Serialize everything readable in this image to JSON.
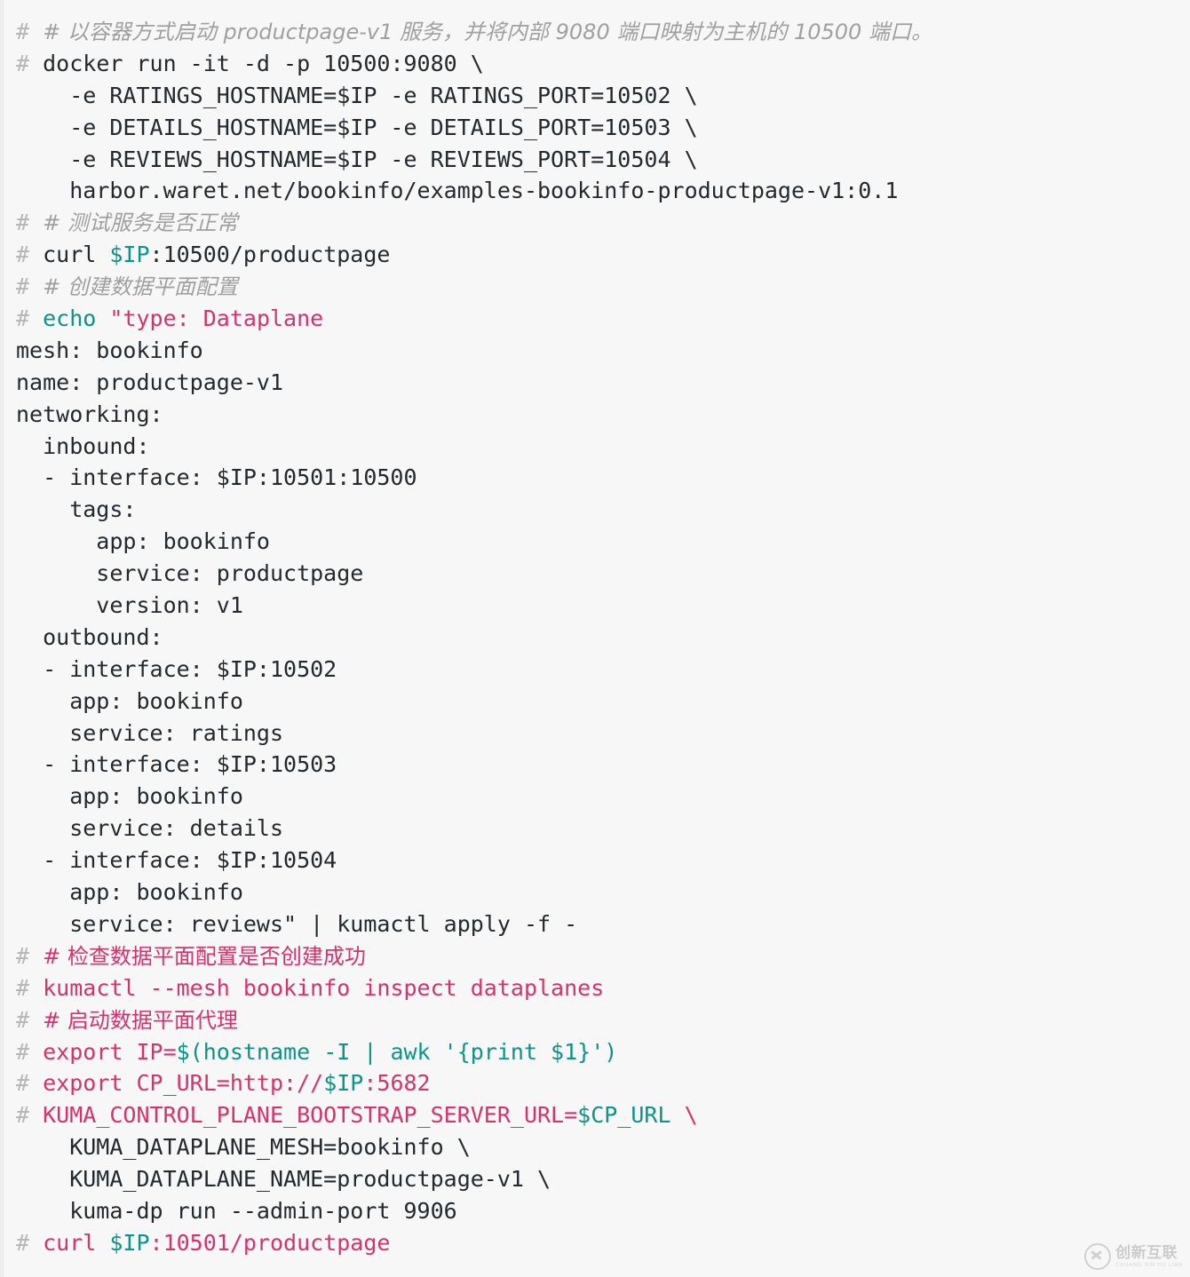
{
  "document": {
    "kind": "terminal-code-block",
    "background_color": "#f7f7f7",
    "colors": {
      "plain": "#24292e",
      "comment_gray": "#a0a0a0",
      "prefix_gray": "#b6b6b6",
      "variable_teal": "#0d9488",
      "string_crimson": "#d6336c"
    }
  },
  "lines": [
    {
      "id": "line-1",
      "tokens": [
        {
          "t": "# ",
          "c": "prefix"
        },
        {
          "t": "# 以容器方式启动 productpage-v1 服务，并将内部 9080 端口映射为主机的 10500 端口。",
          "c": "comment",
          "cjk": true
        }
      ]
    },
    {
      "id": "line-2",
      "tokens": [
        {
          "t": "# ",
          "c": "prefix"
        },
        {
          "t": "docker run -it -d -p 10500:9080 \\",
          "c": "plain"
        }
      ]
    },
    {
      "id": "line-3",
      "tokens": [
        {
          "t": "    -e RATINGS_HOSTNAME=$IP -e RATINGS_PORT=10502 \\",
          "c": "plain"
        }
      ]
    },
    {
      "id": "line-4",
      "tokens": [
        {
          "t": "    -e DETAILS_HOSTNAME=$IP -e DETAILS_PORT=10503 \\",
          "c": "plain"
        }
      ]
    },
    {
      "id": "line-5",
      "tokens": [
        {
          "t": "    -e REVIEWS_HOSTNAME=$IP -e REVIEWS_PORT=10504 \\",
          "c": "plain"
        }
      ]
    },
    {
      "id": "line-6",
      "tokens": [
        {
          "t": "    harbor.waret.net/bookinfo/examples-bookinfo-productpage-v1:0.1",
          "c": "plain"
        }
      ]
    },
    {
      "id": "line-7",
      "tokens": [
        {
          "t": "# ",
          "c": "prefix"
        },
        {
          "t": "# 测试服务是否正常",
          "c": "comment",
          "cjk": true
        }
      ]
    },
    {
      "id": "line-8",
      "tokens": [
        {
          "t": "# ",
          "c": "prefix"
        },
        {
          "t": "curl ",
          "c": "plain"
        },
        {
          "t": "$IP",
          "c": "var"
        },
        {
          "t": ":10500/productpage",
          "c": "plain"
        }
      ]
    },
    {
      "id": "line-9",
      "tokens": [
        {
          "t": "# ",
          "c": "prefix"
        },
        {
          "t": "# 创建数据平面配置",
          "c": "comment",
          "cjk": true
        }
      ]
    },
    {
      "id": "line-10",
      "tokens": [
        {
          "t": "# ",
          "c": "prefix"
        },
        {
          "t": "echo ",
          "c": "teal"
        },
        {
          "t": "\"type: Dataplane",
          "c": "crimson"
        }
      ]
    },
    {
      "id": "line-11",
      "tokens": [
        {
          "t": "mesh: bookinfo",
          "c": "plain"
        }
      ]
    },
    {
      "id": "line-12",
      "tokens": [
        {
          "t": "name: productpage-v1",
          "c": "plain"
        }
      ]
    },
    {
      "id": "line-13",
      "tokens": [
        {
          "t": "networking:",
          "c": "plain"
        }
      ]
    },
    {
      "id": "line-14",
      "tokens": [
        {
          "t": "  inbound:",
          "c": "plain"
        }
      ]
    },
    {
      "id": "line-15",
      "tokens": [
        {
          "t": "  - interface: $IP:10501:10500",
          "c": "plain"
        }
      ]
    },
    {
      "id": "line-16",
      "tokens": [
        {
          "t": "    tags:",
          "c": "plain"
        }
      ]
    },
    {
      "id": "line-17",
      "tokens": [
        {
          "t": "      app: bookinfo",
          "c": "plain"
        }
      ]
    },
    {
      "id": "line-18",
      "tokens": [
        {
          "t": "      service: productpage",
          "c": "plain"
        }
      ]
    },
    {
      "id": "line-19",
      "tokens": [
        {
          "t": "      version: v1",
          "c": "plain"
        }
      ]
    },
    {
      "id": "line-20",
      "tokens": [
        {
          "t": "  outbound:",
          "c": "plain"
        }
      ]
    },
    {
      "id": "line-21",
      "tokens": [
        {
          "t": "  - interface: $IP:10502",
          "c": "plain"
        }
      ]
    },
    {
      "id": "line-22",
      "tokens": [
        {
          "t": "    app: bookinfo",
          "c": "plain"
        }
      ]
    },
    {
      "id": "line-23",
      "tokens": [
        {
          "t": "    service: ratings",
          "c": "plain"
        }
      ]
    },
    {
      "id": "line-24",
      "tokens": [
        {
          "t": "  - interface: $IP:10503",
          "c": "plain"
        }
      ]
    },
    {
      "id": "line-25",
      "tokens": [
        {
          "t": "    app: bookinfo",
          "c": "plain"
        }
      ]
    },
    {
      "id": "line-26",
      "tokens": [
        {
          "t": "    service: details",
          "c": "plain"
        }
      ]
    },
    {
      "id": "line-27",
      "tokens": [
        {
          "t": "  - interface: $IP:10504",
          "c": "plain"
        }
      ]
    },
    {
      "id": "line-28",
      "tokens": [
        {
          "t": "    app: bookinfo",
          "c": "plain"
        }
      ]
    },
    {
      "id": "line-29",
      "tokens": [
        {
          "t": "    service: reviews\" | kumactl apply -f -",
          "c": "plain"
        }
      ]
    },
    {
      "id": "line-30",
      "tokens": [
        {
          "t": "# ",
          "c": "prefix"
        },
        {
          "t": "# 检查数据平面配置是否创建成功",
          "c": "crimson",
          "cjk": true
        }
      ]
    },
    {
      "id": "line-31",
      "tokens": [
        {
          "t": "# ",
          "c": "prefix"
        },
        {
          "t": "kumactl --mesh bookinfo inspect dataplanes",
          "c": "crimson"
        }
      ]
    },
    {
      "id": "line-32",
      "tokens": [
        {
          "t": "# ",
          "c": "prefix"
        },
        {
          "t": "# 启动数据平面代理",
          "c": "crimson",
          "cjk": true
        }
      ]
    },
    {
      "id": "line-33",
      "tokens": [
        {
          "t": "# ",
          "c": "prefix"
        },
        {
          "t": "export ",
          "c": "crimson"
        },
        {
          "t": "IP=",
          "c": "crimson"
        },
        {
          "t": "$(hostname -I | awk '{print $1}')",
          "c": "teal"
        }
      ]
    },
    {
      "id": "line-34",
      "tokens": [
        {
          "t": "# ",
          "c": "prefix"
        },
        {
          "t": "export CP_URL=http://",
          "c": "crimson"
        },
        {
          "t": "$IP",
          "c": "teal"
        },
        {
          "t": ":5682",
          "c": "crimson"
        }
      ]
    },
    {
      "id": "line-35",
      "tokens": [
        {
          "t": "# ",
          "c": "prefix"
        },
        {
          "t": "KUMA_CONTROL_PLANE_BOOTSTRAP_SERVER_URL=",
          "c": "crimson"
        },
        {
          "t": "$CP_URL",
          "c": "teal"
        },
        {
          "t": " \\",
          "c": "crimson"
        }
      ]
    },
    {
      "id": "line-36",
      "tokens": [
        {
          "t": "    KUMA_DATAPLANE_MESH=bookinfo \\",
          "c": "plain"
        }
      ]
    },
    {
      "id": "line-37",
      "tokens": [
        {
          "t": "    KUMA_DATAPLANE_NAME=productpage-v1 \\",
          "c": "plain"
        }
      ]
    },
    {
      "id": "line-38",
      "tokens": [
        {
          "t": "    kuma-dp run --admin-port 9906",
          "c": "plain"
        }
      ]
    },
    {
      "id": "line-39",
      "tokens": [
        {
          "t": "# ",
          "c": "prefix"
        },
        {
          "t": "curl ",
          "c": "crimson"
        },
        {
          "t": "$IP",
          "c": "teal"
        },
        {
          "t": ":10501/productpage",
          "c": "crimson"
        }
      ]
    }
  ],
  "watermark": {
    "logo_icon": "circle-x-logo-icon",
    "brand_cn": "创新互联",
    "brand_en": "CHUANG XIN HU LIAN"
  }
}
